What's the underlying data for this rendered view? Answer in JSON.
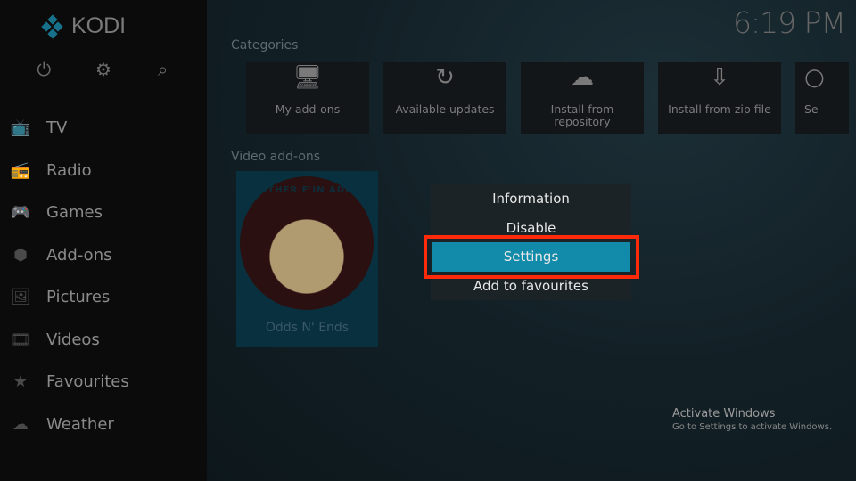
{
  "app": {
    "name": "KODI",
    "clock": "6:19 PM"
  },
  "top_icons": [
    {
      "name": "power-icon",
      "glyph": "⏻"
    },
    {
      "name": "gear-icon",
      "glyph": "⚙"
    },
    {
      "name": "search-icon",
      "glyph": "⌕"
    }
  ],
  "sidebar": {
    "items": [
      {
        "label": "TV",
        "icon": "📺"
      },
      {
        "label": "Radio",
        "icon": "📻"
      },
      {
        "label": "Games",
        "icon": "🎮"
      },
      {
        "label": "Add-ons",
        "icon": "⬢"
      },
      {
        "label": "Pictures",
        "icon": "🖼"
      },
      {
        "label": "Videos",
        "icon": "🎞"
      },
      {
        "label": "Favourites",
        "icon": "★"
      },
      {
        "label": "Weather",
        "icon": "☁"
      }
    ]
  },
  "main": {
    "categories_title": "Categories",
    "categories": [
      {
        "label": "My add-ons",
        "icon": "🖥"
      },
      {
        "label": "Available updates",
        "icon": "↻"
      },
      {
        "label": "Install from repository",
        "icon": "☁"
      },
      {
        "label": "Install from zip file",
        "icon": "⇩"
      },
      {
        "label": "Se",
        "icon": "○"
      }
    ],
    "video_addons_title": "Video add-ons",
    "addon": {
      "name": "Odds N' Ends",
      "logo_text": "ANOTHER F'IN ADDON"
    }
  },
  "context_menu": {
    "items": [
      "Information",
      "Disable",
      "Settings",
      "Add to favourites"
    ],
    "selected": "Settings"
  },
  "colors": {
    "accent": "#128aa9",
    "highlight_border": "#ff2a0a"
  },
  "watermark": {
    "title": "Activate Windows",
    "subtitle": "Go to Settings to activate Windows."
  }
}
